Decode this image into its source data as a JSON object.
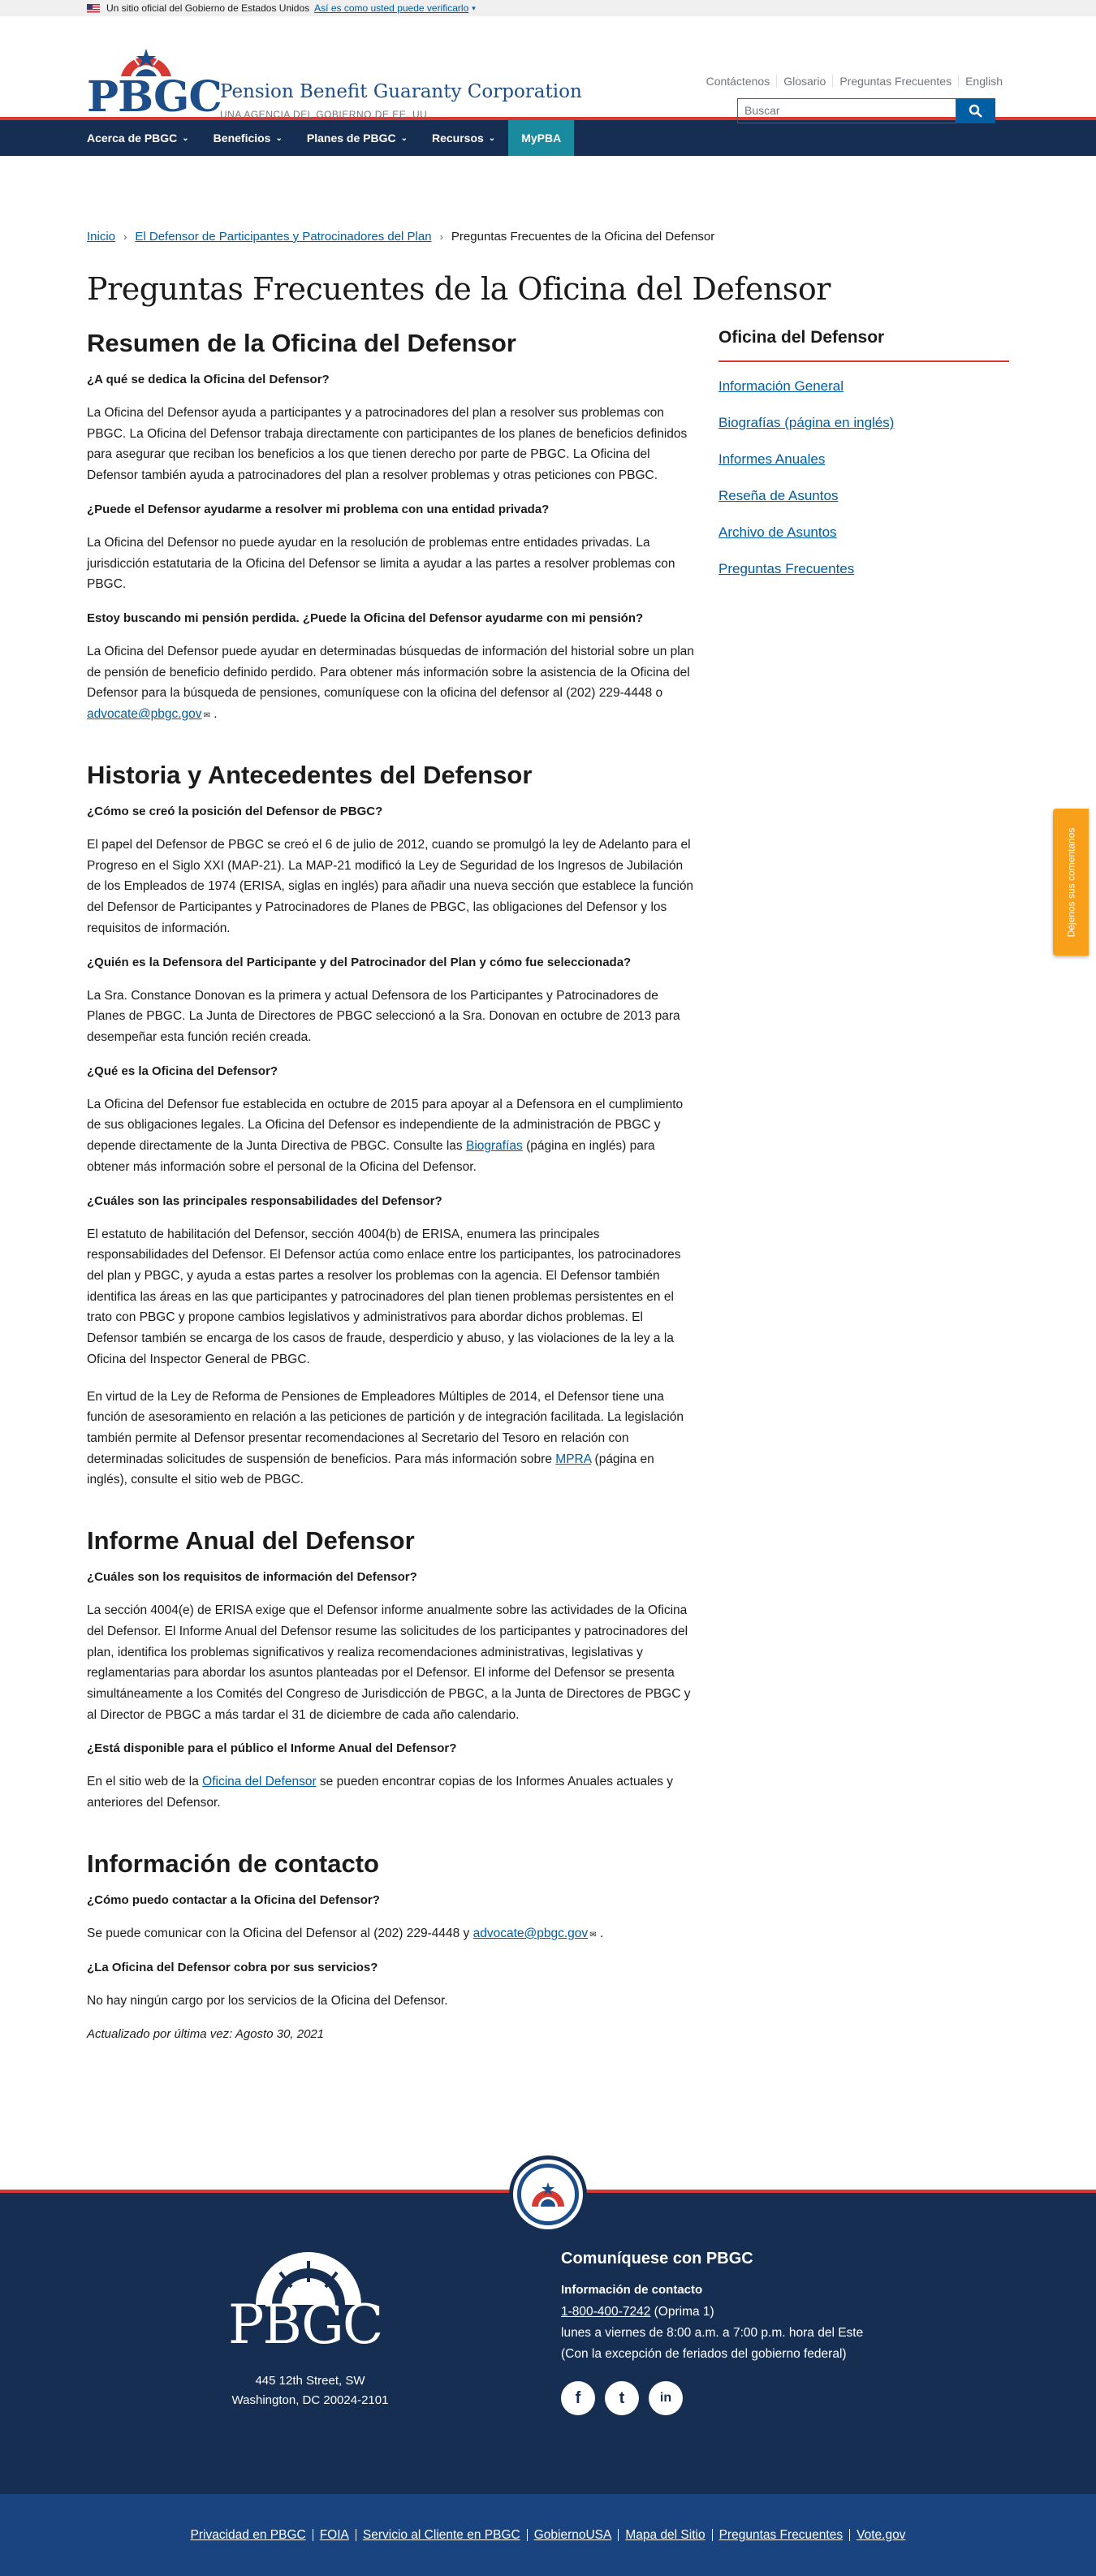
{
  "gov_banner": {
    "text": "Un sitio oficial del Gobierno de Estados Unidos",
    "link": "Así es como usted puede verificarlo"
  },
  "header": {
    "logo_text": "PBGC",
    "org_name": "Pension Benefit Guaranty Corporation",
    "org_sub": "UNA AGENCIA DEL GOBIERNO DE EE. UU.",
    "util_links": [
      "Contáctenos",
      "Glosario",
      "Preguntas Frecuentes",
      "English"
    ],
    "search_placeholder": "Buscar"
  },
  "nav": {
    "items": [
      "Acerca de PBGC",
      "Beneficios",
      "Planes de PBGC",
      "Recursos"
    ],
    "mypba": "MyPBA"
  },
  "breadcrumb": [
    "Inicio",
    "El Defensor de Participantes y Patrocinadores del Plan",
    "Preguntas Frecuentes de la Oficina del Defensor"
  ],
  "page_title": "Preguntas Frecuentes de la Oficina del Defensor",
  "sections": {
    "resumen": {
      "title": "Resumen de la Oficina del Defensor",
      "q1": "¿A qué se dedica la Oficina del Defensor?",
      "a1": "La Oficina del Defensor ayuda a participantes y a patrocinadores del plan a resolver sus problemas con PBGC. La Oficina del Defensor trabaja directamente con participantes de los planes de beneficios definidos para asegurar que reciban los beneficios a los que tienen derecho por parte de PBGC. La Oficina del Defensor también ayuda a patrocinadores del plan a resolver problemas y otras peticiones con PBGC.",
      "q2": "¿Puede el Defensor ayudarme a resolver mi problema con una entidad privada?",
      "a2": "La Oficina del Defensor no puede ayudar en la resolución de problemas entre entidades privadas. La jurisdicción estatutaria de la Oficina del Defensor se limita a ayudar a las partes a resolver problemas con PBGC.",
      "q3": "Estoy buscando mi pensión perdida. ¿Puede la Oficina del Defensor ayudarme con mi pensión?",
      "a3": "La Oficina del Defensor puede ayudar en determinadas búsquedas de información del historial sobre un plan de pensión de beneficio definido perdido. Para obtener más información sobre la asistencia de la Oficina del Defensor para la búsqueda de pensiones, comuníquese con la oficina del defensor al (202) 229-4448 o",
      "a3_link": "advocate@pbgc.gov",
      "a3_end": "."
    },
    "historia": {
      "title": "Historia y Antecedentes del Defensor",
      "q1": "¿Cómo se creó la posición del Defensor de PBGC?",
      "a1": "El papel del Defensor de PBGC se creó el 6 de julio de 2012, cuando se promulgó la ley de Adelanto para el Progreso en el Siglo XXI (MAP-21). La MAP-21 modificó la Ley de Seguridad de los Ingresos de Jubilación de los Empleados de 1974 (ERISA, siglas en inglés) para añadir una nueva sección que establece la función del Defensor de Participantes y Patrocinadores de Planes de PBGC, las obligaciones del Defensor y los requisitos de información.",
      "q2": "¿Quién es la Defensora del Participante y del Patrocinador del Plan y cómo fue seleccionada?",
      "a2": "La Sra. Constance Donovan es la primera y actual Defensora de los Participantes y Patrocinadores de Planes de PBGC. La Junta de Directores de PBGC seleccionó a la Sra. Donovan en octubre de 2013 para desempeñar esta función recién creada.",
      "q3": "¿Qué es la Oficina del Defensor?",
      "a3": "La Oficina del Defensor fue establecida en octubre de 2015 para apoyar al a Defensora en el cumplimiento de sus obligaciones legales. La Oficina del Defensor es independiente de la administración de PBGC y depende directamente de la Junta Directiva de PBGC. Consulte las",
      "a3_link": "Biografías",
      "a3_end": "(página en inglés) para obtener más información sobre el personal de la Oficina del Defensor.",
      "q4": "¿Cuáles son las principales responsabilidades del Defensor?",
      "a4": "El estatuto de habilitación del Defensor, sección 4004(b) de ERISA, enumera las principales responsabilidades del Defensor. El Defensor actúa como enlace entre los participantes, los patrocinadores del plan y PBGC, y ayuda a estas partes a resolver los problemas con la agencia. El Defensor también identifica las áreas en las que participantes y patrocinadores del plan tienen problemas persistentes en el trato con PBGC y propone cambios legislativos y administrativos para abordar dichos problemas. El Defensor también se encarga de los casos de fraude, desperdicio y abuso, y las violaciones de la ley a la Oficina del Inspector General de PBGC.",
      "a5": "En virtud de la Ley de Reforma de Pensiones de Empleadores Múltiples de 2014, el Defensor tiene una función de asesoramiento en relación a las peticiones de partición y de integración facilitada. La legislación también permite al Defensor presentar recomendaciones al Secretario del Tesoro en relación con determinadas solicitudes de suspensión de beneficios. Para más información sobre",
      "a5_link": "MPRA",
      "a5_end": "(página en inglés), consulte el sitio web de PBGC."
    },
    "informe": {
      "title": "Informe Anual del Defensor",
      "q1": "¿Cuáles son los requisitos de información del Defensor?",
      "a1": "La sección 4004(e) de ERISA exige que el Defensor informe anualmente sobre las actividades de la Oficina del Defensor. El Informe Anual del Defensor resume las solicitudes de los participantes y patrocinadores del plan, identifica los problemas significativos y realiza recomendaciones administrativas, legislativas y reglamentarias para abordar los asuntos planteadas por el Defensor. El informe del Defensor se presenta simultáneamente a los Comités del Congreso de Jurisdicción de PBGC, a la Junta de Directores de PBGC y al Director de PBGC a más tardar el 31 de diciembre de cada año calendario.",
      "q2": "¿Está disponible para el público el Informe Anual del Defensor?",
      "a2": "En el sitio web de la",
      "a2_link": "Oficina del Defensor",
      "a2_end": "se pueden encontrar copias de los Informes Anuales actuales y anteriores del Defensor."
    },
    "contacto": {
      "title": "Información de contacto",
      "q1": "¿Cómo puedo contactar a la Oficina del Defensor?",
      "a1": "Se puede comunicar con la Oficina del Defensor al (202) 229-4448 y",
      "a1_link": "advocate@pbgc.gov",
      "a1_end": ".",
      "q2": "¿La Oficina del Defensor cobra por sus servicios?",
      "a2": "No hay ningún cargo por los servicios de la Oficina del Defensor.",
      "updated": "Actualizado por última vez: Agosto 30, 2021"
    }
  },
  "sidebar": {
    "title": "Oficina del Defensor",
    "items": [
      "Información General",
      "Biografías (página en inglés)",
      "Informes Anuales",
      "Reseña de Asuntos",
      "Archivo de Asuntos",
      "Preguntas Frecuentes"
    ]
  },
  "feedback": "Déjenos sus comentarios",
  "footer": {
    "logo_text": "PBGC",
    "address_1": "445 12th Street, SW",
    "address_2": "Washington, DC 20024-2101",
    "contact_title": "Comuníquese con PBGC",
    "contact_sub": "Información de contacto",
    "phone": "1-800-400-7242",
    "phone_note": "(Oprima 1)",
    "hours": "lunes a viernes de 8:00 a.m. a 7:00 p.m. hora del Este",
    "holidays": "(Con la excepción de feriados del gobierno federal)",
    "social": [
      "f",
      "t",
      "in"
    ],
    "bottom_links": [
      "Privacidad en PBGC",
      "FOIA",
      "Servicio al Cliente en PBGC",
      "GobiernoUSA",
      "Mapa del Sitio",
      "Preguntas Frecuentes",
      "Vote.gov"
    ]
  },
  "colors": {
    "navy": "#162e51",
    "accent_red": "#d83933",
    "link_blue": "#005ea2",
    "brand_blue": "#1d4e89",
    "feedback_orange": "#f9a01b"
  }
}
